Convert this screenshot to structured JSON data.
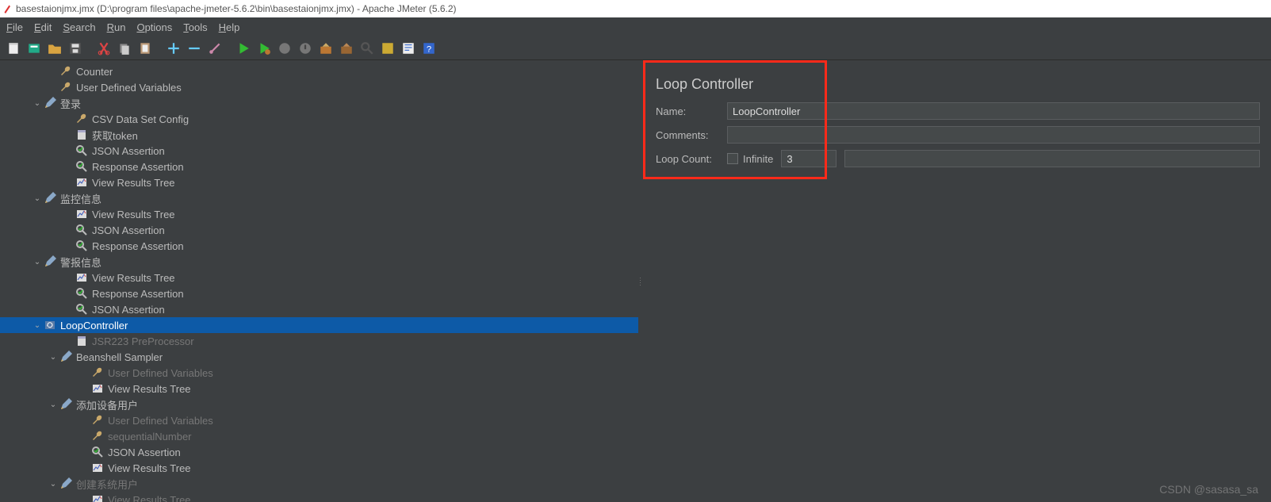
{
  "title": "basestaionjmx.jmx (D:\\program files\\apache-jmeter-5.6.2\\bin\\basestaionjmx.jmx) - Apache JMeter (5.6.2)",
  "menu": {
    "file": "File",
    "edit": "Edit",
    "search": "Search",
    "run": "Run",
    "options": "Options",
    "tools": "Tools",
    "help": "Help"
  },
  "tree": [
    {
      "indent": 3,
      "arrow": "",
      "icon": "wrench",
      "label": "Counter"
    },
    {
      "indent": 3,
      "arrow": "",
      "icon": "wrench",
      "label": "User Defined Variables"
    },
    {
      "indent": 2,
      "arrow": "v",
      "icon": "pencil",
      "label": "登录"
    },
    {
      "indent": 4,
      "arrow": "",
      "icon": "wrench",
      "label": "CSV Data Set Config"
    },
    {
      "indent": 4,
      "arrow": "",
      "icon": "doc",
      "label": "获取token"
    },
    {
      "indent": 4,
      "arrow": "",
      "icon": "assert",
      "label": "JSON Assertion"
    },
    {
      "indent": 4,
      "arrow": "",
      "icon": "assert",
      "label": "Response Assertion"
    },
    {
      "indent": 4,
      "arrow": "",
      "icon": "results",
      "label": "View Results Tree"
    },
    {
      "indent": 2,
      "arrow": "v",
      "icon": "pencil",
      "label": "监控信息"
    },
    {
      "indent": 4,
      "arrow": "",
      "icon": "results",
      "label": "View Results Tree"
    },
    {
      "indent": 4,
      "arrow": "",
      "icon": "assert",
      "label": "JSON Assertion"
    },
    {
      "indent": 4,
      "arrow": "",
      "icon": "assert",
      "label": "Response Assertion"
    },
    {
      "indent": 2,
      "arrow": "v",
      "icon": "pencil",
      "label": "警报信息"
    },
    {
      "indent": 4,
      "arrow": "",
      "icon": "results",
      "label": "View Results Tree"
    },
    {
      "indent": 4,
      "arrow": "",
      "icon": "assert",
      "label": "Response Assertion"
    },
    {
      "indent": 4,
      "arrow": "",
      "icon": "assert",
      "label": "JSON Assertion"
    },
    {
      "indent": 2,
      "arrow": "v",
      "icon": "loop",
      "label": "LoopController",
      "selected": true
    },
    {
      "indent": 4,
      "arrow": "",
      "icon": "doc",
      "label": "JSR223 PreProcessor",
      "dim": true
    },
    {
      "indent": 3,
      "arrow": "v",
      "icon": "pencil",
      "label": "Beanshell Sampler"
    },
    {
      "indent": 5,
      "arrow": "",
      "icon": "wrench",
      "label": "User Defined Variables",
      "dim": true
    },
    {
      "indent": 5,
      "arrow": "",
      "icon": "results",
      "label": "View Results Tree"
    },
    {
      "indent": 3,
      "arrow": "v",
      "icon": "pencil",
      "label": "添加设备用户"
    },
    {
      "indent": 5,
      "arrow": "",
      "icon": "wrench",
      "label": "User Defined Variables",
      "dim": true
    },
    {
      "indent": 5,
      "arrow": "",
      "icon": "wrench",
      "label": "sequentialNumber",
      "dim": true
    },
    {
      "indent": 5,
      "arrow": "",
      "icon": "assert",
      "label": "JSON Assertion"
    },
    {
      "indent": 5,
      "arrow": "",
      "icon": "results",
      "label": "View Results Tree"
    },
    {
      "indent": 3,
      "arrow": "v",
      "icon": "pencil",
      "label": "创建系统用户",
      "dim": true
    },
    {
      "indent": 5,
      "arrow": "",
      "icon": "results",
      "label": "View Results Tree",
      "dim": true
    }
  ],
  "panel": {
    "title": "Loop Controller",
    "name_label": "Name:",
    "name_value": "LoopController",
    "comments_label": "Comments:",
    "comments_value": "",
    "loopcount_label": "Loop Count:",
    "infinite_label": "Infinite",
    "loopcount_value": "3"
  },
  "watermark": "CSDN @sasasa_sa"
}
